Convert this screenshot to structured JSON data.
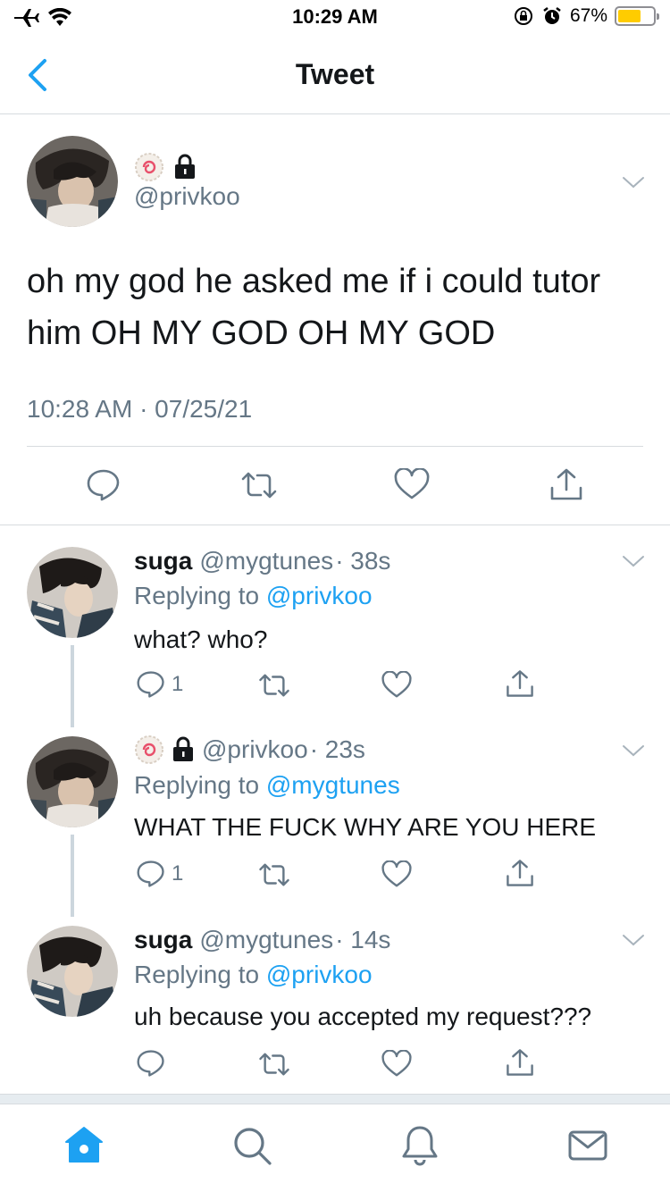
{
  "status_bar": {
    "time": "10:29 AM",
    "battery": "67%",
    "battery_level": 0.67
  },
  "nav": {
    "title": "Tweet"
  },
  "main_tweet": {
    "handle": "@privkoo",
    "text": "oh my god he asked me if i could tutor him OH MY GOD OH MY GOD",
    "timestamp": "10:28 AM · 07/25/21"
  },
  "replies": [
    {
      "name": "suga",
      "handle": "@mygtunes",
      "time": "· 38s",
      "replying_prefix": "Replying to",
      "replying_to": "@privkoo",
      "text": "what? who?",
      "reply_count": "1"
    },
    {
      "name": "",
      "handle": "@privkoo",
      "time": "· 23s",
      "replying_prefix": "Replying to",
      "replying_to": "@mygtunes",
      "text": "WHAT THE FUCK WHY ARE YOU HERE",
      "reply_count": "1"
    },
    {
      "name": "suga",
      "handle": "@mygtunes",
      "time": "· 14s",
      "replying_prefix": "Replying to",
      "replying_to": "@privkoo",
      "text": "uh because you accepted my request???",
      "reply_count": ""
    }
  ],
  "tabs": [
    "home-icon",
    "search-icon",
    "notifications-icon",
    "messages-icon"
  ],
  "colors": {
    "accent": "#1da1f2",
    "text": "#14171a",
    "muted": "#657786",
    "divider": "#d7dbdf"
  }
}
